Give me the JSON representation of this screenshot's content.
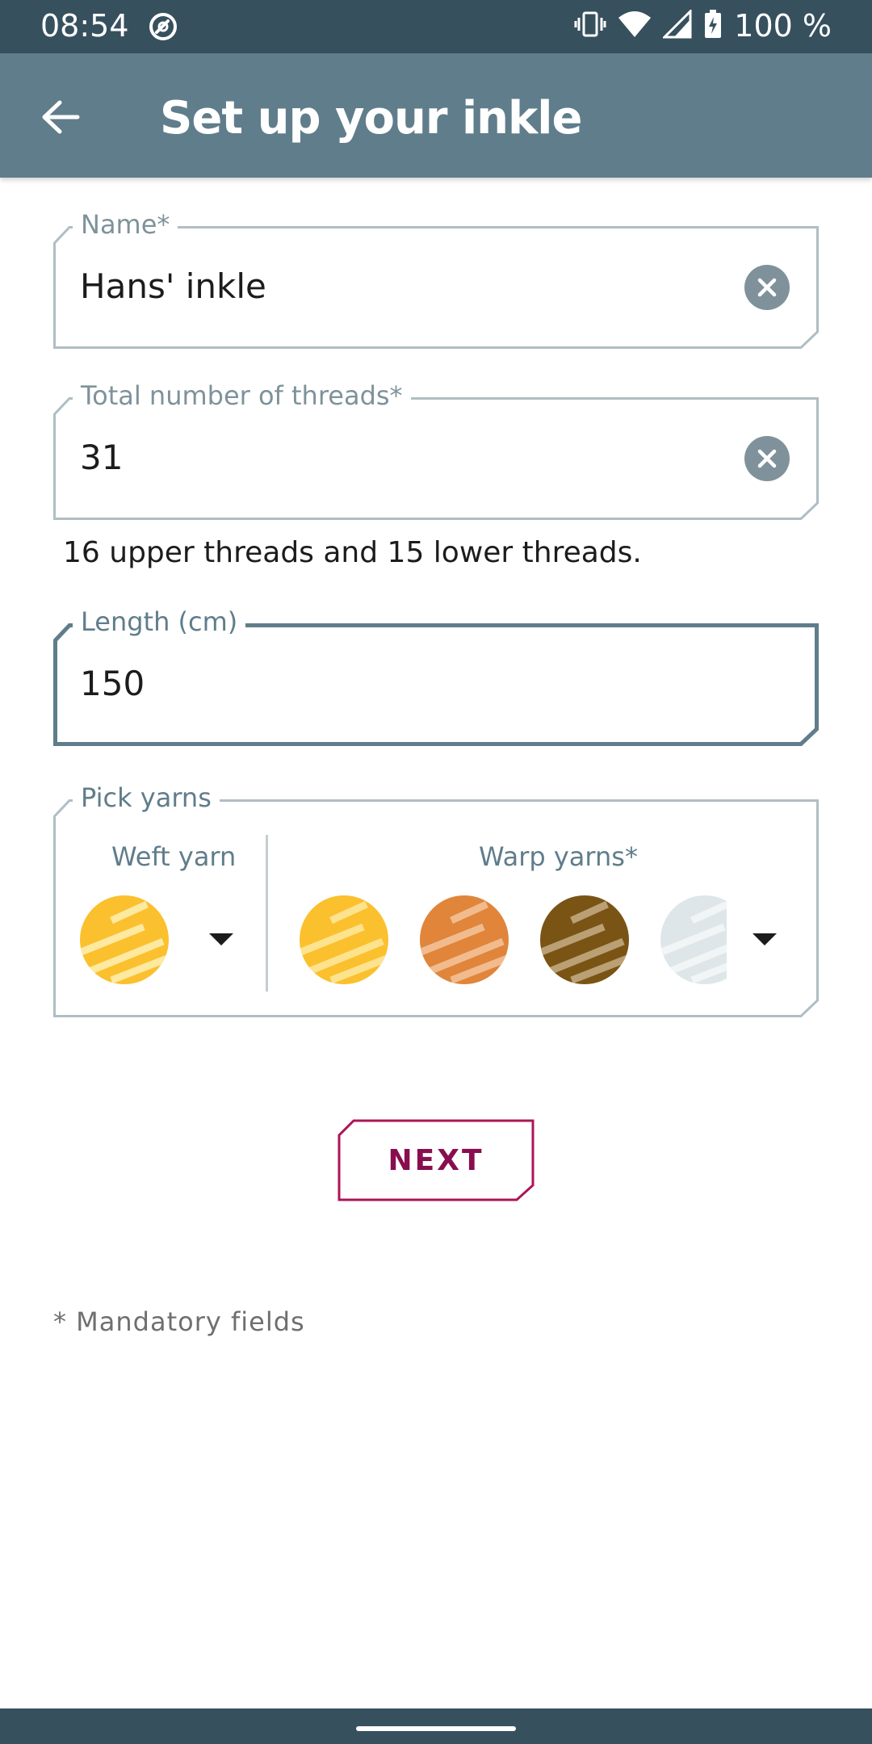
{
  "status_bar": {
    "time": "08:54",
    "battery": "100 %",
    "icons": [
      "sync-icon",
      "vibrate-icon",
      "wifi-icon",
      "signal-icon",
      "battery-charging-icon"
    ]
  },
  "app_bar": {
    "title": "Set up your inkle",
    "back_icon": "arrow-back-icon"
  },
  "form": {
    "name": {
      "label": "Name*",
      "value": "Hans' inkle"
    },
    "threads": {
      "label": "Total number of threads*",
      "value": "31",
      "helper": "16 upper threads and 15 lower threads."
    },
    "length": {
      "label": "Length (cm)",
      "value": "150"
    },
    "yarns": {
      "label": "Pick yarns",
      "weft_label": "Weft yarn",
      "warp_label": "Warp yarns*",
      "weft_color": "#fbc02d",
      "warp_colors": [
        "#fbc02d",
        "#e0853a",
        "#7a5414",
        "#dfe6e9"
      ]
    },
    "next_label": "NEXT",
    "footnote": "* Mandatory fields"
  },
  "colors": {
    "status_bar": "#37505e",
    "app_bar": "#607d8b",
    "accent": "#880e4f",
    "outline": "#b0bec5",
    "focused_outline": "#607d8b"
  }
}
